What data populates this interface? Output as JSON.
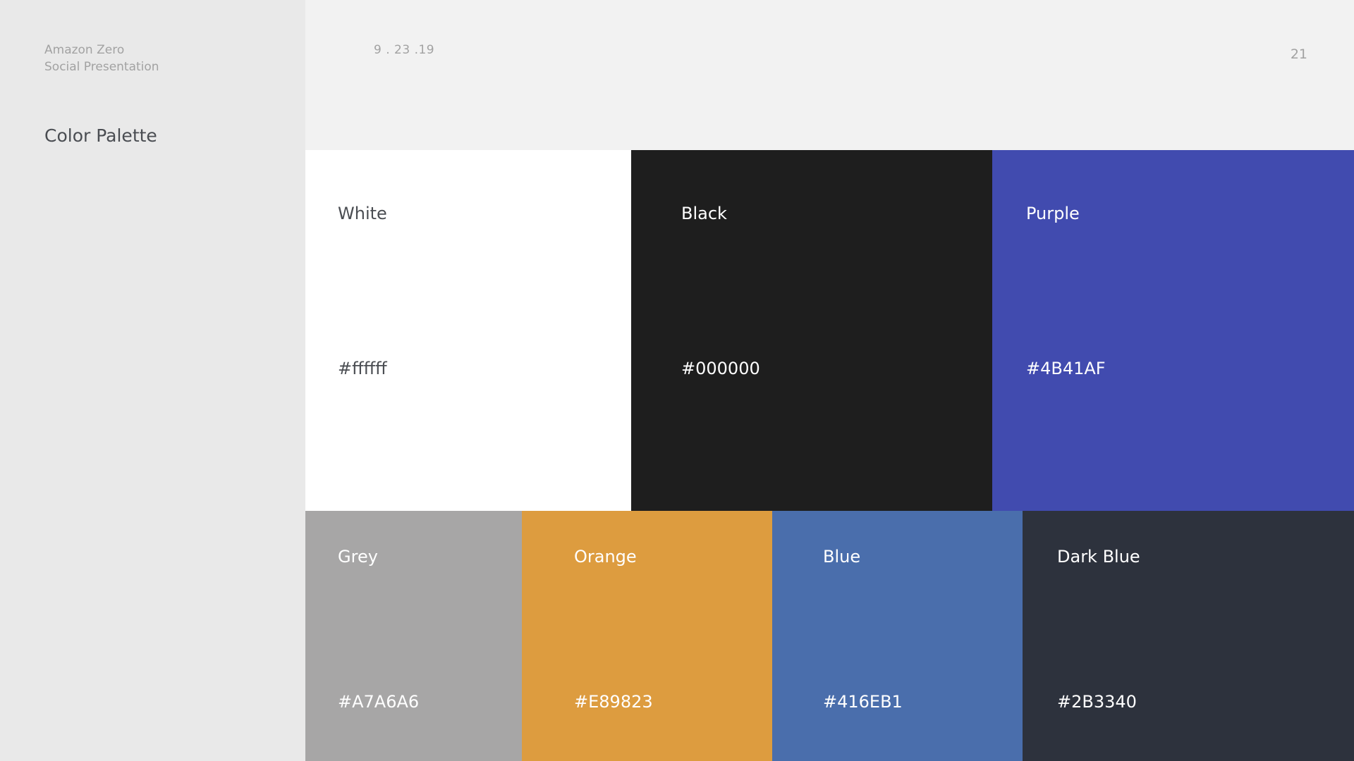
{
  "header": {
    "brand_line1": "Amazon Zero",
    "brand_line2": "Social Presentation",
    "date": "9 . 23 .19",
    "page_number": "21"
  },
  "section_title": "Color Palette",
  "palette": [
    {
      "name": "White",
      "hex": "#ffffff",
      "swatch_color": "#ffffff"
    },
    {
      "name": "Black",
      "hex": "#000000",
      "swatch_color": "#1e1e1e"
    },
    {
      "name": "Purple",
      "hex": "#4B41AF",
      "swatch_color": "#414baf"
    },
    {
      "name": "Grey",
      "hex": "#A7A6A6",
      "swatch_color": "#a7a6a6"
    },
    {
      "name": "Orange",
      "hex": "#E89823",
      "swatch_color": "#dd9c3f"
    },
    {
      "name": "Blue",
      "hex": "#416EB1",
      "swatch_color": "#4a6eac"
    },
    {
      "name": "Dark Blue",
      "hex": "#2B3340",
      "swatch_color": "#2d323d"
    }
  ]
}
